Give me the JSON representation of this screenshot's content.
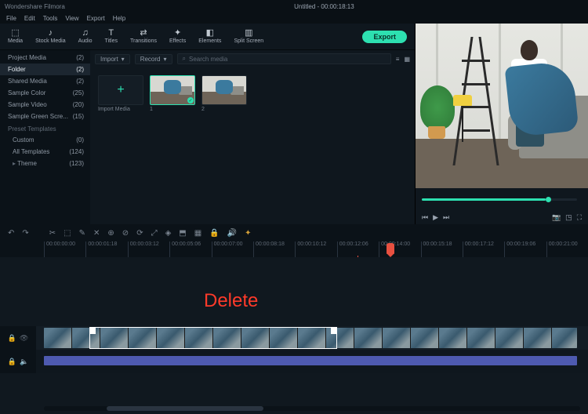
{
  "app_title": "Wondershare Filmora",
  "project_label": "Untitled - 00:00:18:13",
  "menu": [
    "File",
    "Edit",
    "Tools",
    "View",
    "Export",
    "Help"
  ],
  "tabs": [
    {
      "icon": "⬚",
      "label": "Media"
    },
    {
      "icon": "♪",
      "label": "Stock Media"
    },
    {
      "icon": "♫",
      "label": "Audio"
    },
    {
      "icon": "T",
      "label": "Titles"
    },
    {
      "icon": "⇄",
      "label": "Transitions"
    },
    {
      "icon": "✦",
      "label": "Effects"
    },
    {
      "icon": "◧",
      "label": "Elements"
    },
    {
      "icon": "▥",
      "label": "Split Screen"
    }
  ],
  "export_label": "Export",
  "sidebar": {
    "items": [
      {
        "label": "Project Media",
        "count": "(2)"
      },
      {
        "label": "Folder",
        "count": "(2)",
        "active": true
      },
      {
        "label": "Shared Media",
        "count": "(2)"
      },
      {
        "label": "Sample Color",
        "count": "(25)"
      },
      {
        "label": "Sample Video",
        "count": "(20)"
      },
      {
        "label": "Sample Green Scre...",
        "count": "(15)"
      }
    ],
    "category": "Preset Templates",
    "sub": [
      {
        "label": "Custom",
        "count": "(0)"
      },
      {
        "label": "All Templates",
        "count": "(124)"
      }
    ],
    "theme": {
      "label": "Theme",
      "count": "(123)"
    }
  },
  "media_ctrl": {
    "dd1": "Import",
    "dd2": "Record",
    "search_ph": "Search media"
  },
  "thumbs": {
    "import_label": "Import Media",
    "t1": "1",
    "t2": "2"
  },
  "timeline_tools": [
    "↶",
    "↷",
    "✂",
    "⬚",
    "✎",
    "✕",
    "⊕",
    "⊘",
    "⟳",
    "⤢",
    "◈",
    "⬒",
    "▦",
    "🔒",
    "🔊",
    "✦"
  ],
  "ruler_ticks": [
    "00:00:00:00",
    "00:00:01:18",
    "00:00:03:12",
    "00:00:05:06",
    "00:00:07:00",
    "00:00:08:18",
    "00:00:10:12",
    "00:00:12:06",
    "00:00:14:00",
    "00:00:15:18",
    "00:00:17:12",
    "00:00:19:06",
    "00:00:21:00"
  ],
  "annotation_text": "Delete",
  "track_labels": {
    "video": "",
    "audio": ""
  },
  "playhead_pct": 63,
  "accent": "#2de0b0",
  "delete_color": "#ff2a1a"
}
